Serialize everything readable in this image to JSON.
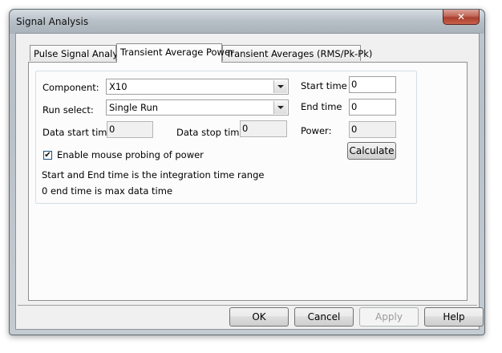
{
  "window": {
    "title": "Signal Analysis",
    "close_glyph": "✕"
  },
  "tabs": [
    {
      "label": "Pulse Signal Analysis",
      "active": false
    },
    {
      "label": "Transient Average Power",
      "active": true
    },
    {
      "label": "Transient Averages (RMS/Pk-Pk)",
      "active": false
    }
  ],
  "form": {
    "component_label": "Component:",
    "component_value": "X10",
    "run_select_label": "Run select:",
    "run_select_value": "Single Run",
    "data_start_label": "Data start time",
    "data_start_value": "0",
    "data_stop_label": "Data stop time",
    "data_stop_value": "0",
    "start_time_label": "Start time",
    "start_time_value": "0",
    "end_time_label": "End time",
    "end_time_value": "0",
    "power_label": "Power:",
    "power_value": "0",
    "calculate_label": "Calculate",
    "mouse_probe_label": "Enable mouse probing of power",
    "mouse_probe_checked": true,
    "checkmark": "✔",
    "note_1": "Start and End time is the integration time range",
    "note_2": "0 end time is max data time"
  },
  "footer": {
    "ok_label": "OK",
    "cancel_label": "Cancel",
    "apply_label": "Apply",
    "help_label": "Help"
  }
}
